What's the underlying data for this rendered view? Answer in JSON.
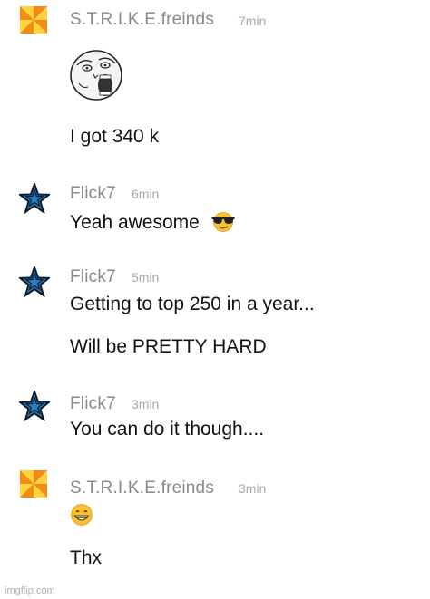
{
  "messages": [
    {
      "user": "S.T.R.I.K.E.freinds",
      "time": "7min",
      "lines": [
        "I got 340 k"
      ],
      "avatar": "pinwheel-avatar",
      "image": "rage-face-lol-sticker"
    },
    {
      "user": "Flick7",
      "time": "6min",
      "lines": [
        "Yeah awesome"
      ],
      "avatar": "blue-star-avatar",
      "emoji": "sunglasses-emoji"
    },
    {
      "user": "Flick7",
      "time": "5min",
      "lines": [
        "Getting to top 250 in a year...",
        "Will be PRETTY HARD"
      ],
      "avatar": "blue-star-avatar"
    },
    {
      "user": "Flick7",
      "time": "3min",
      "lines": [
        "You can do it though...."
      ],
      "avatar": "blue-star-avatar"
    },
    {
      "user": "S.T.R.I.K.E.freinds",
      "time": "3min",
      "lines": [
        "Thx"
      ],
      "avatar": "pinwheel-avatar",
      "emoji": "grinning-emoji"
    }
  ],
  "watermark": "imgflip.com",
  "colors": {
    "username": "#8a8a8a",
    "timestamp": "#a8a8a8",
    "star_blue": "#2a7fc2",
    "pinwheel_orange": "#f28a1c",
    "pinwheel_yellow": "#ffd43a"
  }
}
